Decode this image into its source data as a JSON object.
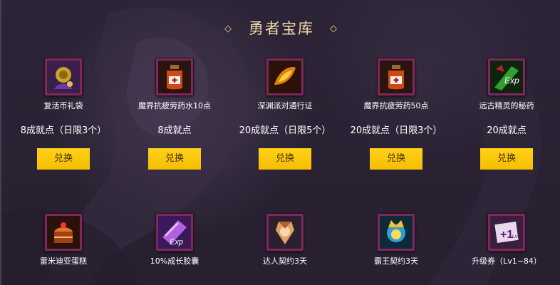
{
  "title": "勇者宝库",
  "rows": [
    [
      {
        "name": "复活币礼袋",
        "price": "8成就点（日限3个）",
        "button": "兑换",
        "icon": "revive-coin-bag-icon"
      },
      {
        "name": "魔界抗疲劳药水10点",
        "price": "8成就点",
        "button": "兑换",
        "icon": "fatigue-potion-icon"
      },
      {
        "name": "深渊派对通行证",
        "price": "20成就点（日限5个）",
        "button": "兑换",
        "icon": "abyss-pass-icon"
      },
      {
        "name": "魔界抗疲劳药50点",
        "price": "20成就点（日限3个）",
        "button": "兑换",
        "icon": "fatigue-potion-icon"
      },
      {
        "name": "远古精灵的秘药",
        "price": "20成就点",
        "button": "兑换",
        "icon": "exp-potion-icon"
      }
    ],
    [
      {
        "name": "雷米迪亚蛋糕",
        "icon": "cake-icon"
      },
      {
        "name": "10%成长胶囊",
        "icon": "exp-capsule-icon"
      },
      {
        "name": "达人契约3天",
        "icon": "master-contract-icon"
      },
      {
        "name": "霸王契约3天",
        "icon": "overlord-contract-icon"
      },
      {
        "name": "升级券（Lv1~84）",
        "icon": "level-up-ticket-icon"
      }
    ]
  ]
}
